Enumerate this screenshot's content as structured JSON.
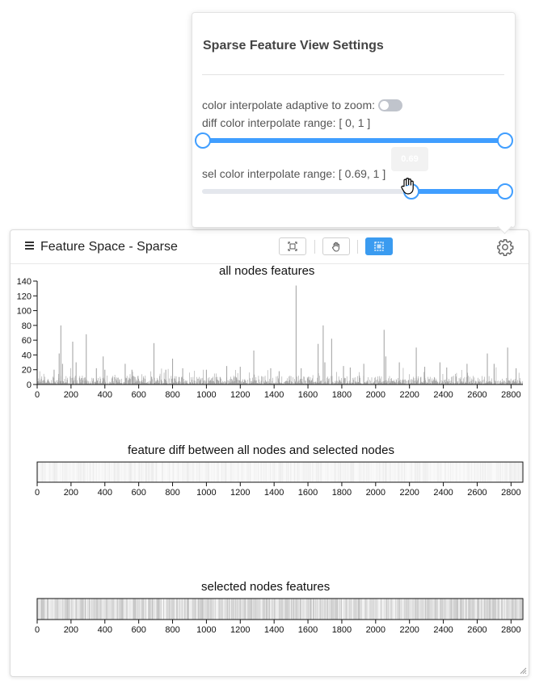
{
  "panel": {
    "title": "Feature Space - Sparse",
    "tools": [
      {
        "name": "fit-view",
        "active": false
      },
      {
        "name": "pan",
        "active": false
      },
      {
        "name": "select",
        "active": true
      }
    ]
  },
  "settings": {
    "title": "Sparse Feature View Settings",
    "adaptive_label": "color interpolate adaptive to zoom:",
    "adaptive_enabled": false,
    "diff_label": "diff color interpolate range: [ 0, 1 ]",
    "diff_range": [
      0,
      1
    ],
    "sel_label": "sel color interpolate range: [ 0.69, 1 ]",
    "sel_range": [
      0.69,
      1
    ],
    "tooltip": "0.69"
  },
  "chart_data": [
    {
      "type": "bar",
      "title": "all nodes features",
      "xlim": [
        0,
        2870
      ],
      "ylim": [
        0,
        140
      ],
      "x_ticks": [
        0,
        200,
        400,
        600,
        800,
        1000,
        1200,
        1400,
        1600,
        1800,
        2000,
        2200,
        2400,
        2600,
        2800
      ],
      "y_ticks": [
        0,
        20,
        40,
        60,
        80,
        100,
        120,
        140
      ],
      "peaks": [
        {
          "x": 100,
          "y": 20
        },
        {
          "x": 130,
          "y": 42
        },
        {
          "x": 140,
          "y": 80
        },
        {
          "x": 150,
          "y": 28
        },
        {
          "x": 210,
          "y": 58
        },
        {
          "x": 230,
          "y": 30
        },
        {
          "x": 290,
          "y": 68
        },
        {
          "x": 350,
          "y": 22
        },
        {
          "x": 390,
          "y": 38
        },
        {
          "x": 400,
          "y": 20
        },
        {
          "x": 520,
          "y": 28
        },
        {
          "x": 560,
          "y": 20
        },
        {
          "x": 690,
          "y": 56
        },
        {
          "x": 760,
          "y": 20
        },
        {
          "x": 800,
          "y": 35
        },
        {
          "x": 860,
          "y": 22
        },
        {
          "x": 1000,
          "y": 20
        },
        {
          "x": 1120,
          "y": 25
        },
        {
          "x": 1200,
          "y": 24
        },
        {
          "x": 1280,
          "y": 46
        },
        {
          "x": 1380,
          "y": 22
        },
        {
          "x": 1430,
          "y": 18
        },
        {
          "x": 1530,
          "y": 134
        },
        {
          "x": 1560,
          "y": 22
        },
        {
          "x": 1660,
          "y": 55
        },
        {
          "x": 1690,
          "y": 80
        },
        {
          "x": 1700,
          "y": 30
        },
        {
          "x": 1740,
          "y": 62
        },
        {
          "x": 1810,
          "y": 25
        },
        {
          "x": 1850,
          "y": 23
        },
        {
          "x": 1930,
          "y": 28
        },
        {
          "x": 2050,
          "y": 74
        },
        {
          "x": 2060,
          "y": 38
        },
        {
          "x": 2140,
          "y": 30
        },
        {
          "x": 2240,
          "y": 50
        },
        {
          "x": 2290,
          "y": 24
        },
        {
          "x": 2380,
          "y": 30
        },
        {
          "x": 2420,
          "y": 23
        },
        {
          "x": 2540,
          "y": 28
        },
        {
          "x": 2660,
          "y": 42
        },
        {
          "x": 2700,
          "y": 28
        },
        {
          "x": 2780,
          "y": 50
        },
        {
          "x": 2830,
          "y": 22
        }
      ]
    },
    {
      "type": "heatmap",
      "title": "feature diff between all nodes and selected nodes",
      "xlim": [
        0,
        2870
      ],
      "x_ticks": [
        0,
        200,
        400,
        600,
        800,
        1000,
        1200,
        1400,
        1600,
        1800,
        2000,
        2200,
        2400,
        2600,
        2800
      ]
    },
    {
      "type": "heatmap",
      "title": "selected nodes features",
      "xlim": [
        0,
        2870
      ],
      "x_ticks": [
        0,
        200,
        400,
        600,
        800,
        1000,
        1200,
        1400,
        1600,
        1800,
        2000,
        2200,
        2400,
        2600,
        2800
      ]
    }
  ]
}
